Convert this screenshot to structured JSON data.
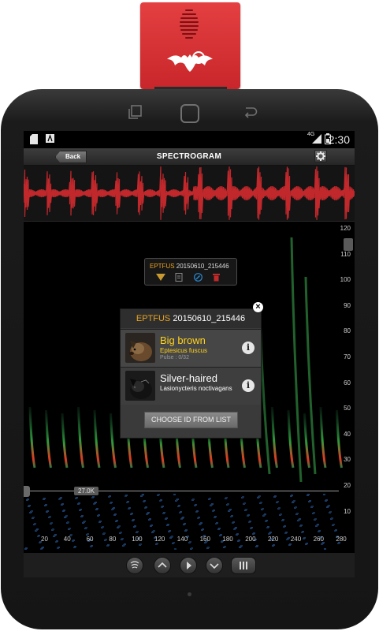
{
  "statusbar": {
    "network": "4G",
    "time": "2:30"
  },
  "actionbar": {
    "back_label": "Back",
    "title": "SPECTROGRAM"
  },
  "tag": {
    "code": "EPTFUS",
    "id": " 20150610_215446"
  },
  "popup": {
    "code": "EPTFUS",
    "id": " 20150610_215446",
    "species": [
      {
        "name": "Big brown",
        "latin": "Eptesicus fuscus",
        "pulse": "Pulse : 0/32",
        "color": "#ffd21a"
      },
      {
        "name": "Silver-haired",
        "latin": "Lasionycteris noctivagans",
        "color": "#ffffff"
      }
    ],
    "choose_label": "CHOOSE ID FROM LIST"
  },
  "spectrogram": {
    "threshold_label": "27.0K",
    "y_ticks": [
      "120",
      "110",
      "100",
      "90",
      "80",
      "70",
      "60",
      "50",
      "40",
      "30",
      "20",
      "10"
    ],
    "x_ticks": [
      "20",
      "40",
      "60",
      "80",
      "100",
      "120",
      "140",
      "160",
      "180",
      "200",
      "220",
      "240",
      "260",
      "280"
    ]
  },
  "colors": {
    "accent": "#e8a321",
    "waveform": "#c0282c",
    "device": "#d8302f"
  },
  "icons": [
    "gear-icon",
    "speaker-icon",
    "up-arrow-icon",
    "play-icon",
    "down-arrow-icon",
    "pause-icon",
    "close-icon",
    "info-icon"
  ]
}
